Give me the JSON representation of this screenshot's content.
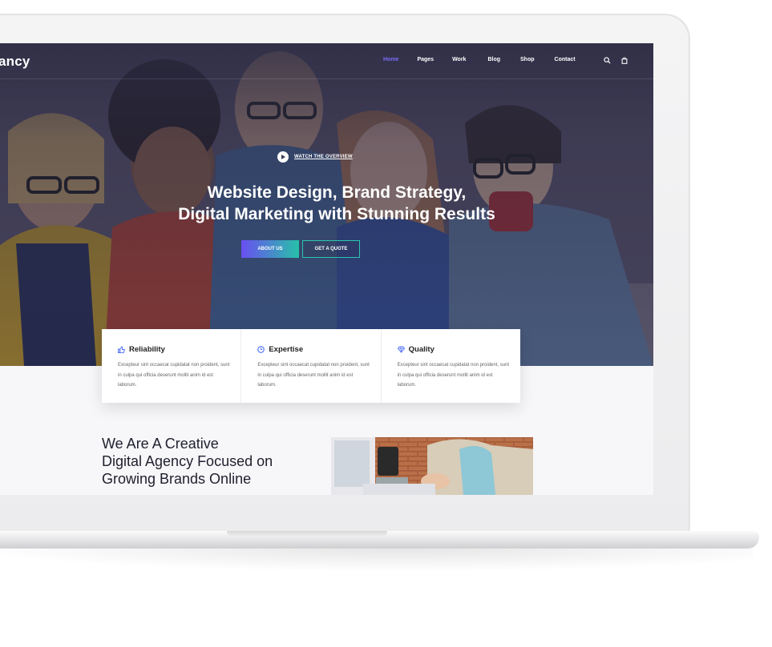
{
  "site": {
    "logo": "ancy",
    "nav": [
      {
        "label": "Home",
        "active": true
      },
      {
        "label": "Pages",
        "active": false
      },
      {
        "label": "Work",
        "active": false
      },
      {
        "label": "Blog",
        "active": false
      },
      {
        "label": "Shop",
        "active": false
      },
      {
        "label": "Contact",
        "active": false
      }
    ],
    "search_icon": "search-icon",
    "cart_icon": "shopping-bag-icon"
  },
  "hero": {
    "watch_label": "WATCH THE OVERVIEW",
    "title_line1": "Website Design, Brand Strategy,",
    "title_line2": "Digital Marketing with Stunning Results",
    "primary_button": "ABOUT US",
    "secondary_button": "GET A QUOTE"
  },
  "features": [
    {
      "icon": "thumbs-up-icon",
      "title": "Reliability",
      "text": "Excepteur sint occaecat cupidatat non proident, sunt in culpa qui officia deserunt mollit anim id est laborum."
    },
    {
      "icon": "clock-icon",
      "title": "Expertise",
      "text": "Excepteur sint occaecat cupidatat non proident, sunt in culpa qui officia deserunt mollit anim id est laborum."
    },
    {
      "icon": "diamond-icon",
      "title": "Quality",
      "text": "Excepteur sint occaecat cupidatat non proident, sunt in culpa qui officia deserunt mollit anim id est laborum."
    }
  ],
  "about": {
    "heading_line1": "We Are A Creative",
    "heading_line2": "Digital Agency Focused on",
    "heading_line3": "Growing Brands Online"
  },
  "colors": {
    "accent": "#7c6cf5",
    "teal": "#2cc6b0",
    "hero_overlay": "#2c2b42"
  }
}
